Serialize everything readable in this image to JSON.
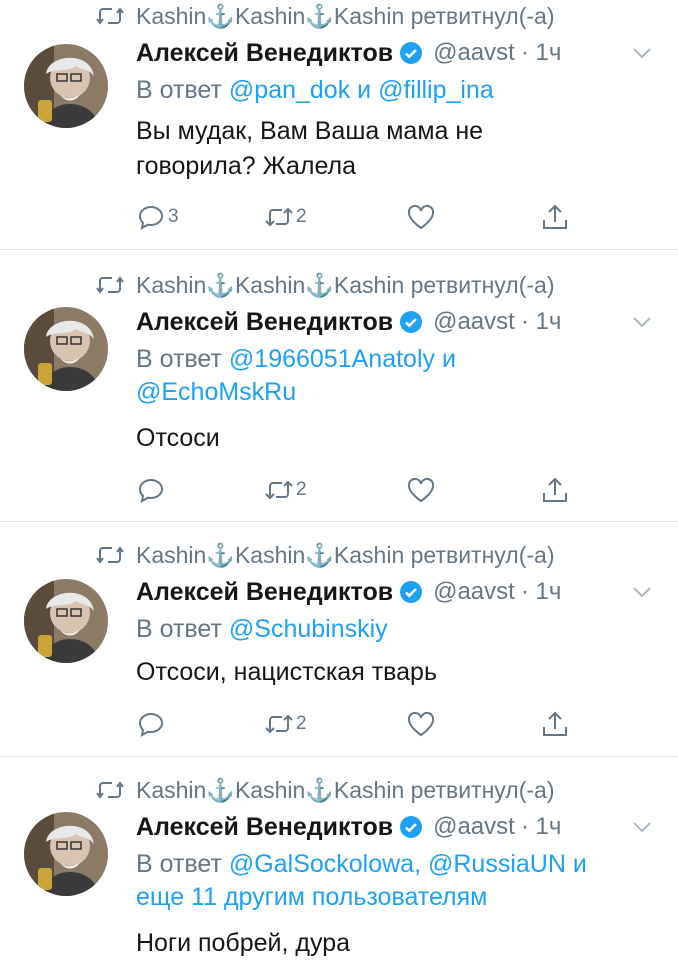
{
  "colors": {
    "accent": "#1da1f2",
    "secondary_text": "#657786",
    "primary_text": "#14171a",
    "divider": "#e1e8ed"
  },
  "tweets": [
    {
      "retweet_text": "Kashin⚓Kashin⚓Kashin ретвитнул(-а)",
      "author_name": "Алексей Венедиктов",
      "handle": "@aavst",
      "time": "· 1ч",
      "reply_prefix": "В ответ ",
      "reply_line1": "@pan_dok и @fillip_ina",
      "reply_line2": "",
      "text_line1": "Вы мудак, Вам Ваша мама не",
      "text_line2": "говорила? Жалела",
      "reply_count": "3",
      "retweet_count": "2"
    },
    {
      "retweet_text": "Kashin⚓Kashin⚓Kashin ретвитнул(-а)",
      "author_name": "Алексей Венедиктов",
      "handle": "@aavst",
      "time": "· 1ч",
      "reply_prefix": "В ответ ",
      "reply_line1": "@1966051Anatoly и",
      "reply_line2": "@EchoMskRu",
      "text_line1": "Отсоси",
      "text_line2": "",
      "reply_count": "",
      "retweet_count": "2"
    },
    {
      "retweet_text": "Kashin⚓Kashin⚓Kashin ретвитнул(-а)",
      "author_name": "Алексей Венедиктов",
      "handle": "@aavst",
      "time": "· 1ч",
      "reply_prefix": "В ответ ",
      "reply_line1": "@Schubinskiy",
      "reply_line2": "",
      "text_line1": "Отсоси, нацистская тварь",
      "text_line2": "",
      "reply_count": "",
      "retweet_count": "2"
    },
    {
      "retweet_text": "Kashin⚓Kashin⚓Kashin ретвитнул(-а)",
      "author_name": "Алексей Венедиктов",
      "handle": "@aavst",
      "time": "· 1ч",
      "reply_prefix": "В ответ ",
      "reply_line1": "@GalSockolowa, @RussiaUN и",
      "reply_line2": "еще 11 другим пользователям",
      "text_line1": "Ноги побрей, дура",
      "text_line2": "",
      "reply_count": "",
      "retweet_count": ""
    }
  ],
  "icons": [
    "retweet-icon",
    "verified-icon",
    "chevron-down-icon",
    "reply-icon",
    "heart-icon",
    "share-icon"
  ]
}
